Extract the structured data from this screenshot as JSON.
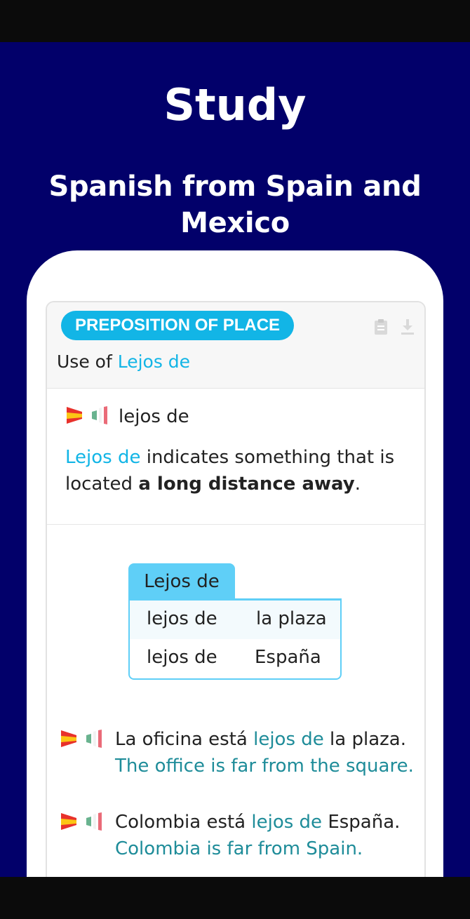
{
  "promo": {
    "title": "Study",
    "subtitle": "Spanish from Spain and Mexico"
  },
  "card": {
    "category": "PREPOSITION OF PLACE",
    "header_icons": [
      "clipboard-icon",
      "download-icon"
    ],
    "usage_prefix": "Use of ",
    "usage_term": "Lejos de",
    "word": "lejos de",
    "definition": {
      "term": "Lejos de",
      "middle": " indicates something that is located ",
      "bold": "a long distance away",
      "end": "."
    },
    "table": {
      "tab_label": "Lejos de",
      "rows": [
        [
          "lejos de",
          "la plaza"
        ],
        [
          "lejos de",
          "España"
        ]
      ]
    },
    "examples": [
      {
        "before": "La oficina está ",
        "highlight": "lejos de",
        "after": " la plaza.",
        "translation": "The office is far from the square."
      },
      {
        "before": "Colombia está ",
        "highlight": "lejos de",
        "after": " España.",
        "translation": "Colombia is far from Spain."
      }
    ]
  },
  "colors": {
    "background": "#02006a",
    "accent": "#12b5e6",
    "translation": "#1e8c99",
    "table_border": "#5fcff7"
  }
}
